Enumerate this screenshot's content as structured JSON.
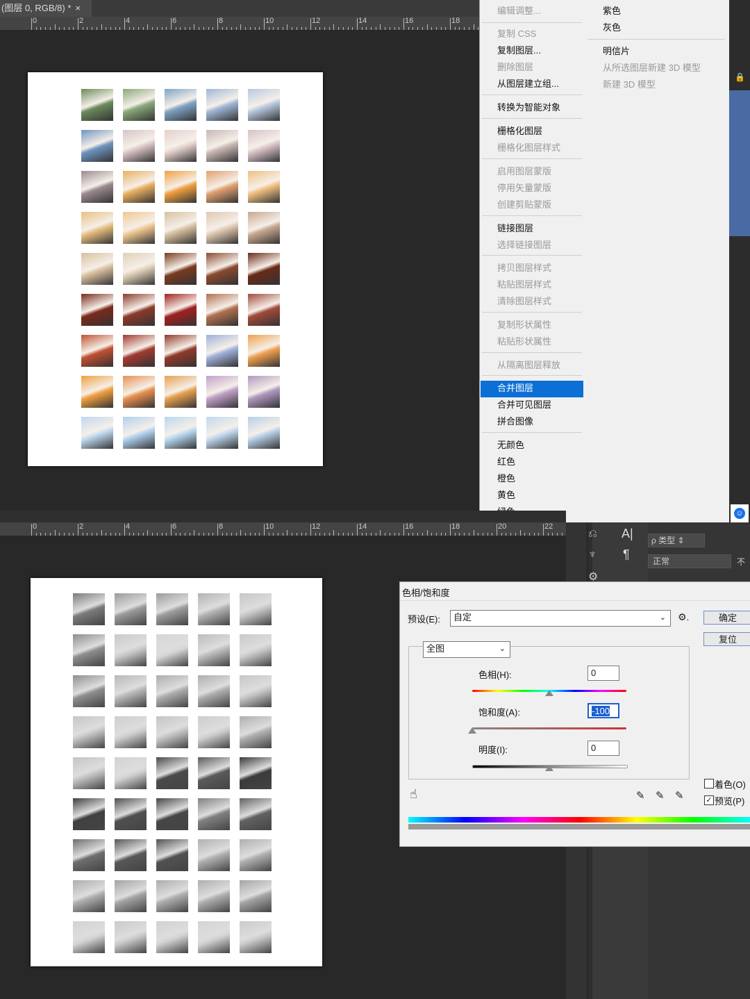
{
  "document_tab": {
    "title": "(图层 0, RGB/8) *",
    "close": "×"
  },
  "ruler_numbers": [
    "0",
    "2",
    "4",
    "6",
    "8",
    "10",
    "12",
    "14",
    "16",
    "18",
    "20",
    "22"
  ],
  "context_menu": {
    "items": [
      {
        "label": "编辑调整...",
        "enabled": false
      },
      {
        "label": "复制 CSS",
        "enabled": false
      },
      {
        "label": "复制图层...",
        "enabled": true
      },
      {
        "label": "删除图层",
        "enabled": false
      },
      {
        "label": "从图层建立组...",
        "enabled": true
      },
      {
        "label": "转换为智能对象",
        "enabled": true
      },
      {
        "label": "栅格化图层",
        "enabled": true
      },
      {
        "label": "栅格化图层样式",
        "enabled": false
      },
      {
        "label": "启用图层蒙版",
        "enabled": false
      },
      {
        "label": "停用矢量蒙版",
        "enabled": false
      },
      {
        "label": "创建剪贴蒙版",
        "enabled": false
      },
      {
        "label": "链接图层",
        "enabled": true
      },
      {
        "label": "选择链接图层",
        "enabled": false
      },
      {
        "label": "拷贝图层样式",
        "enabled": false
      },
      {
        "label": "粘贴图层样式",
        "enabled": false
      },
      {
        "label": "清除图层样式",
        "enabled": false
      },
      {
        "label": "复制形状属性",
        "enabled": false
      },
      {
        "label": "粘贴形状属性",
        "enabled": false
      },
      {
        "label": "从隔离图层释放",
        "enabled": false
      },
      {
        "label": "合并图层",
        "enabled": true,
        "highlighted": true
      },
      {
        "label": "合并可见图层",
        "enabled": true
      },
      {
        "label": "拼合图像",
        "enabled": true
      },
      {
        "label": "无颜色",
        "enabled": true
      },
      {
        "label": "红色",
        "enabled": true
      },
      {
        "label": "橙色",
        "enabled": true
      },
      {
        "label": "黄色",
        "enabled": true
      },
      {
        "label": "绿色",
        "enabled": true
      }
    ],
    "sub_items": [
      {
        "label": "紫色",
        "enabled": true
      },
      {
        "label": "灰色",
        "enabled": true
      },
      {
        "label": "明信片",
        "enabled": true
      },
      {
        "label": "从所选图层新建 3D 模型",
        "enabled": false
      },
      {
        "label": "新建 3D 模型",
        "enabled": false
      }
    ]
  },
  "layers_panel": {
    "filter_label": "ρ 类型",
    "blend_mode": "正常",
    "opacity_label": "不"
  },
  "hue_sat_dialog": {
    "title": "色相/饱和度",
    "preset_label": "预设(E):",
    "preset_value": "自定",
    "channel_value": "全图",
    "hue_label": "色相(H):",
    "hue_value": "0",
    "saturation_label": "饱和度(A):",
    "saturation_value": "-100",
    "lightness_label": "明度(I):",
    "lightness_value": "0",
    "ok_label": "确定",
    "reset_label": "复位",
    "colorize_label": "着色(O)",
    "preview_label": "预览(P)",
    "preview_checked": true,
    "colorize_checked": false,
    "hue_position": 0.5,
    "saturation_position": 0.0,
    "lightness_position": 0.5
  },
  "photo_grid": {
    "rows": 9,
    "cols": 5
  }
}
